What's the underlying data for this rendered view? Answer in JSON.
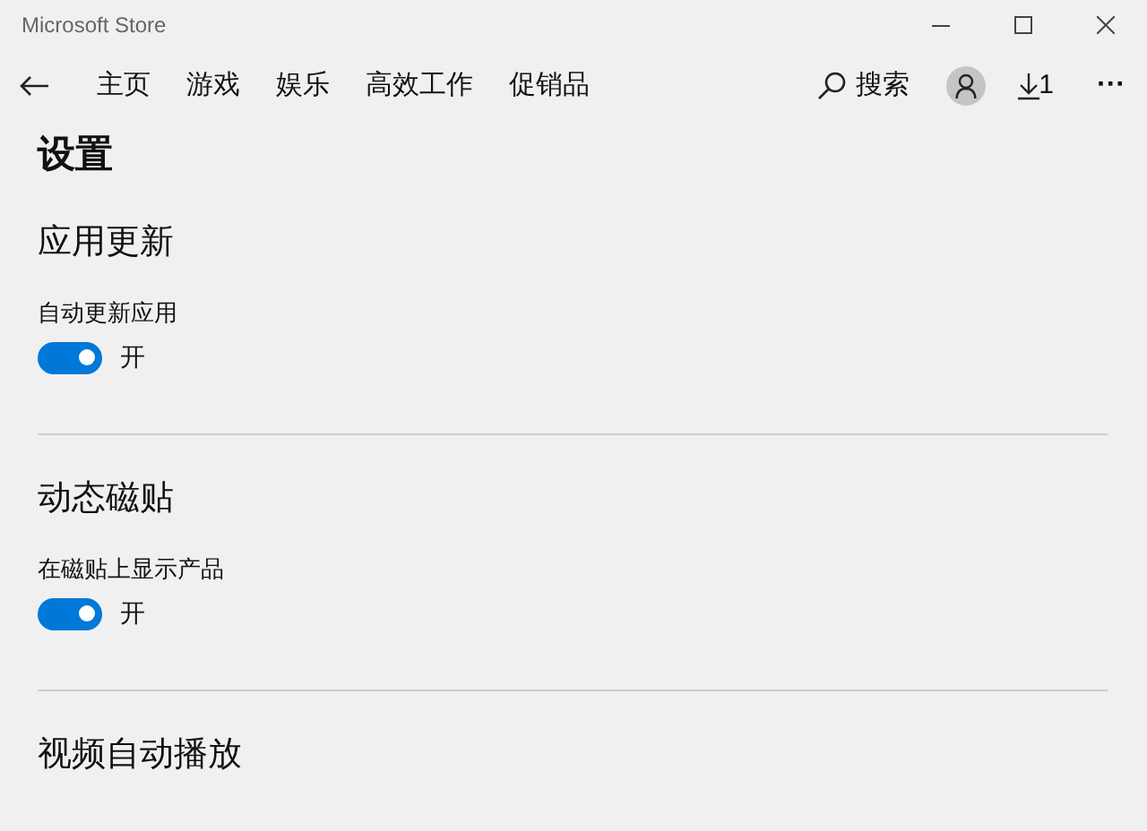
{
  "window": {
    "title": "Microsoft Store"
  },
  "nav": {
    "tabs": [
      {
        "label": "主页"
      },
      {
        "label": "游戏"
      },
      {
        "label": "娱乐"
      },
      {
        "label": "高效工作"
      },
      {
        "label": "促销品"
      }
    ],
    "search": "搜索",
    "downloads": "1",
    "more": "···"
  },
  "page_title": "设置",
  "sections": [
    {
      "heading": "应用更新",
      "setting": {
        "label": "自动更新应用",
        "on": true,
        "state": "开"
      }
    },
    {
      "heading": "动态磁贴",
      "setting": {
        "label": "在磁贴上显示产品",
        "on": true,
        "state": "开"
      }
    },
    {
      "heading": "视频自动播放"
    }
  ]
}
